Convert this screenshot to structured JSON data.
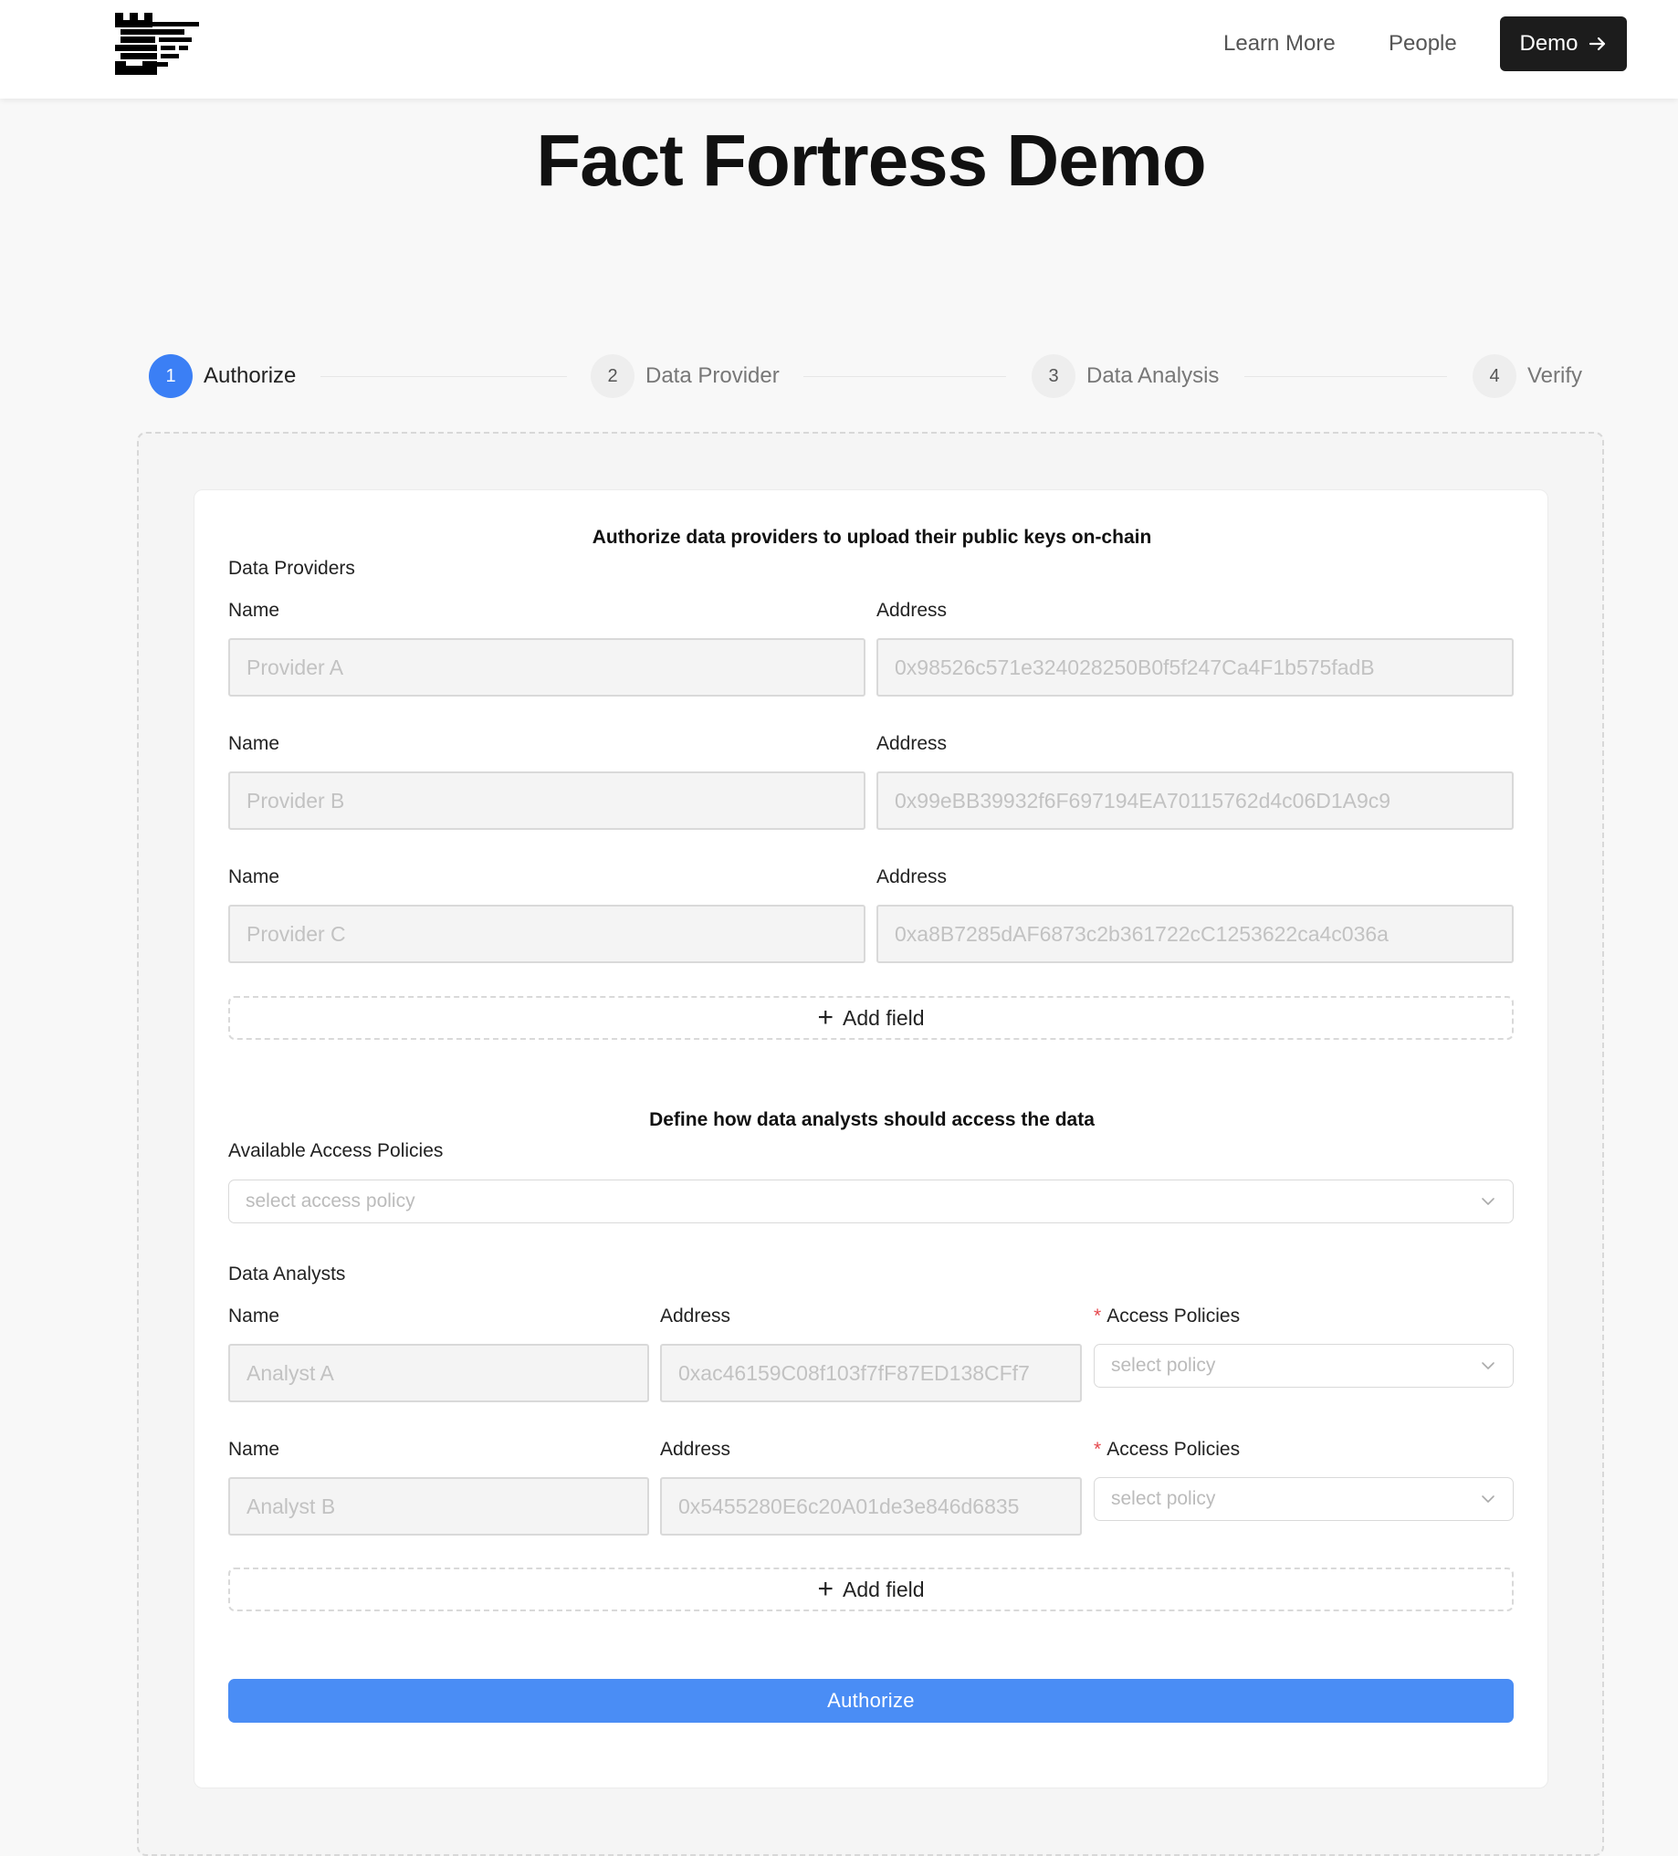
{
  "header": {
    "logo_icon": "fortress-logo-icon",
    "nav": {
      "learn_more": "Learn More",
      "people": "People",
      "demo": "Demo"
    }
  },
  "title": "Fact Fortress Demo",
  "steps": [
    {
      "number": "1",
      "label": "Authorize",
      "active": true
    },
    {
      "number": "2",
      "label": "Data Provider",
      "active": false
    },
    {
      "number": "3",
      "label": "Data Analysis",
      "active": false
    },
    {
      "number": "4",
      "label": "Verify",
      "active": false
    }
  ],
  "colors": {
    "accent": "#3b7ff5",
    "button_primary": "#4a8df5",
    "dark_button": "#1c1c1c",
    "required": "#e5484d"
  },
  "providers_section": {
    "title": "Authorize data providers to upload their public keys on-chain",
    "group_label": "Data Providers",
    "name_label": "Name",
    "address_label": "Address",
    "rows": [
      {
        "name": "Provider A",
        "address": "0x98526c571e324028250B0f5f247Ca4F1b575fadB"
      },
      {
        "name": "Provider B",
        "address": "0x99eBB39932f6F697194EA70115762d4c06D1A9c9"
      },
      {
        "name": "Provider C",
        "address": "0xa8B7285dAF6873c2b361722cC1253622ca4c036a"
      }
    ],
    "add_field": "Add field"
  },
  "analysts_section": {
    "title": "Define how data analysts should access the data",
    "policies_label": "Available Access Policies",
    "policies_placeholder": "select access policy",
    "group_label": "Data Analysts",
    "name_label": "Name",
    "address_label": "Address",
    "policy_label": "Access Policies",
    "required_mark": "*",
    "policy_placeholder": "select policy",
    "rows": [
      {
        "name": "Analyst A",
        "address": "0xac46159C08f103f7fF87ED138CFf7"
      },
      {
        "name": "Analyst B",
        "address": "0x5455280E6c20A01de3e846d6835"
      }
    ],
    "add_field": "Add field"
  },
  "authorize_button": "Authorize"
}
